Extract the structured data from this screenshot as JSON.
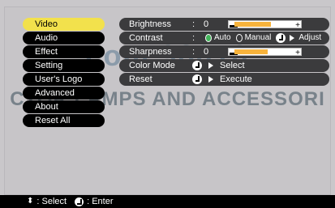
{
  "watermark": {
    "line1": "com 98010",
    "line2": "CTOR LAMPS AND ACCESSORI"
  },
  "sidebar": {
    "items": [
      {
        "label": "Video"
      },
      {
        "label": "Audio"
      },
      {
        "label": "Effect"
      },
      {
        "label": "Setting"
      },
      {
        "label": "User's Logo"
      },
      {
        "label": "Advanced"
      },
      {
        "label": "About"
      },
      {
        "label": "Reset All"
      }
    ]
  },
  "settings": {
    "brightness": {
      "label": "Brightness",
      "colon": ":",
      "value": "0",
      "level_percent": 60
    },
    "contrast": {
      "label": "Contrast",
      "colon": ":",
      "auto": "Auto",
      "manual": "Manual",
      "adjust": "Adjust"
    },
    "sharpness": {
      "label": "Sharpness",
      "colon": ":",
      "value": "0",
      "level_percent": 55
    },
    "color_mode": {
      "label": "Color Mode",
      "action": "Select"
    },
    "reset": {
      "label": "Reset",
      "action": "Execute"
    }
  },
  "footer": {
    "select": ": Select",
    "enter": ": Enter"
  },
  "colors": {
    "selected_menu": "#f2e14c",
    "slider_fill": "#f7b33c",
    "radio_on": "#41b55a"
  }
}
